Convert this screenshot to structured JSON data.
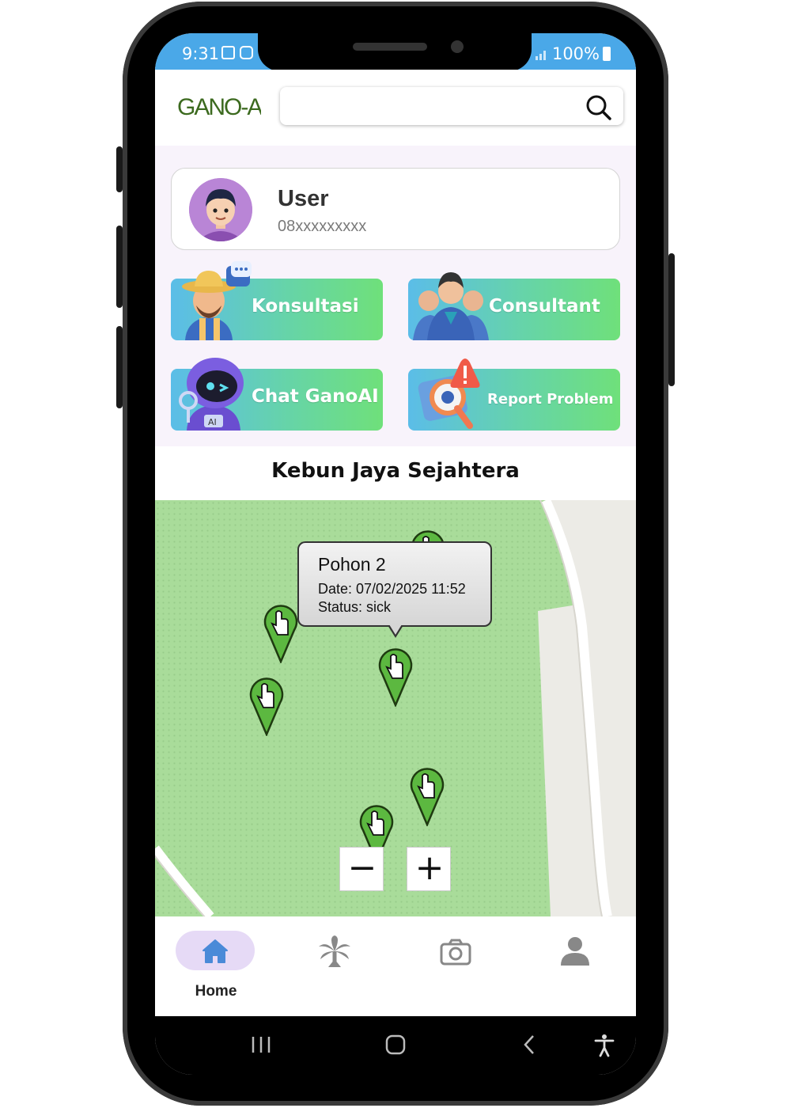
{
  "status_bar": {
    "time": "9:31",
    "battery": "100%"
  },
  "app": {
    "logo_text": "GANO-Ai"
  },
  "search": {
    "value": "",
    "placeholder": ""
  },
  "user": {
    "name": "User",
    "phone": "08xxxxxxxxx"
  },
  "menu": [
    {
      "label": "Konsultasi"
    },
    {
      "label": "Consultant"
    },
    {
      "label": "Chat GanoAI"
    },
    {
      "label": "Report Problem"
    }
  ],
  "farm": {
    "title": "Kebun Jaya Sejahtera"
  },
  "map": {
    "tooltip": {
      "title": "Pohon 2",
      "date": "Date: 07/02/2025 11:52",
      "status": "Status: sick"
    },
    "zoom_out_label": "−",
    "zoom_in_label": "+"
  },
  "bottom_nav": [
    {
      "label": "Home",
      "icon": "home-icon",
      "active": true
    },
    {
      "label": "",
      "icon": "palm-tree-icon",
      "active": false
    },
    {
      "label": "",
      "icon": "camera-icon",
      "active": false
    },
    {
      "label": "",
      "icon": "profile-icon",
      "active": false
    }
  ],
  "colors": {
    "status_bar": "#4aa8e8",
    "tile_gradient_start": "#5bbde8",
    "tile_gradient_end": "#6fe07a",
    "map_green": "#a9dc9a",
    "marker_green": "#5cb840",
    "nav_active_pill": "#e6daf6",
    "home_icon": "#4a8ad8"
  }
}
